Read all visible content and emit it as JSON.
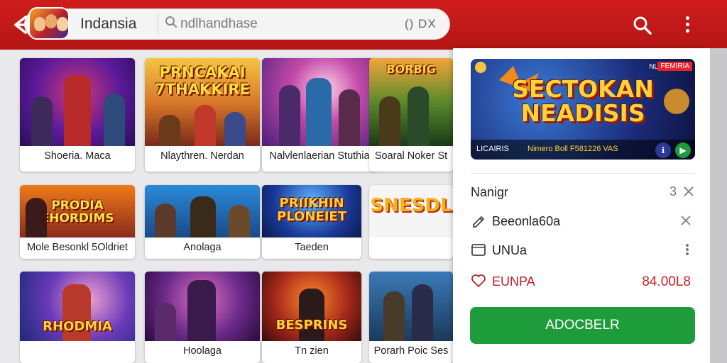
{
  "header": {
    "title": "Indansia",
    "search_placeholder": "ndlhandhase",
    "pill_tag": "() DX",
    "back_icon": "arrow-left-icon",
    "search_icon": "search-icon",
    "menu_icon": "more-vertical-icon"
  },
  "games": [
    {
      "art_title": "PRNCAKAI 7THAKKIRE",
      "badge": "",
      "caption": "Shoeria. Maca"
    },
    {
      "art_title": "",
      "badge": "",
      "caption": "Nlaythren. Nerdan"
    },
    {
      "art_title": "BORBIG",
      "badge": "",
      "caption": "Nalvlenlaerian Stuthia"
    },
    {
      "art_title": "",
      "badge": "",
      "caption": "Soaral Noker St"
    },
    {
      "art_title": "PRODIA EHORDIMS",
      "badge": "",
      "caption": "Mole Besonkl 5Oldriet"
    },
    {
      "art_title": "",
      "badge": "",
      "caption": "Anolaga"
    },
    {
      "art_title": "PRIIKHIN PLONEIET",
      "badge": "",
      "caption": "Taeden"
    },
    {
      "art_title": "SNESDL",
      "badge": "",
      "caption": ""
    },
    {
      "art_title": "RHODMIA",
      "badge": "",
      "caption": ""
    },
    {
      "art_title": "",
      "badge": "",
      "caption": "Hoolaga"
    },
    {
      "art_title": "BESPRINS",
      "badge": "",
      "caption": "Tn zien"
    },
    {
      "art_title": "",
      "badge": "",
      "caption": "Porarh Poic Ses"
    }
  ],
  "detail": {
    "banner": {
      "title": "SECTOKAN NEADISIS",
      "badge": "FEMIRIA",
      "footer_left": "LICAIRIS",
      "footer_mid": "Nimero Boll F581226 VAS"
    },
    "rows": [
      {
        "label": "Nanigr",
        "right": "3",
        "icon": "close-icon"
      },
      {
        "label": "Beeonla60a",
        "icon": "edit-icon",
        "right_icon": "close-icon"
      },
      {
        "label": "UNUa",
        "icon": "window-icon",
        "right_icon": "more-vertical-icon"
      },
      {
        "label": "EUNPA",
        "icon": "heart-icon",
        "value": "84.00L8"
      }
    ],
    "cta_label": "ADOCBELR"
  },
  "colors": {
    "header_red": "#c81b1b",
    "cta_green": "#1e9b3b",
    "price_red": "#d3202a"
  }
}
